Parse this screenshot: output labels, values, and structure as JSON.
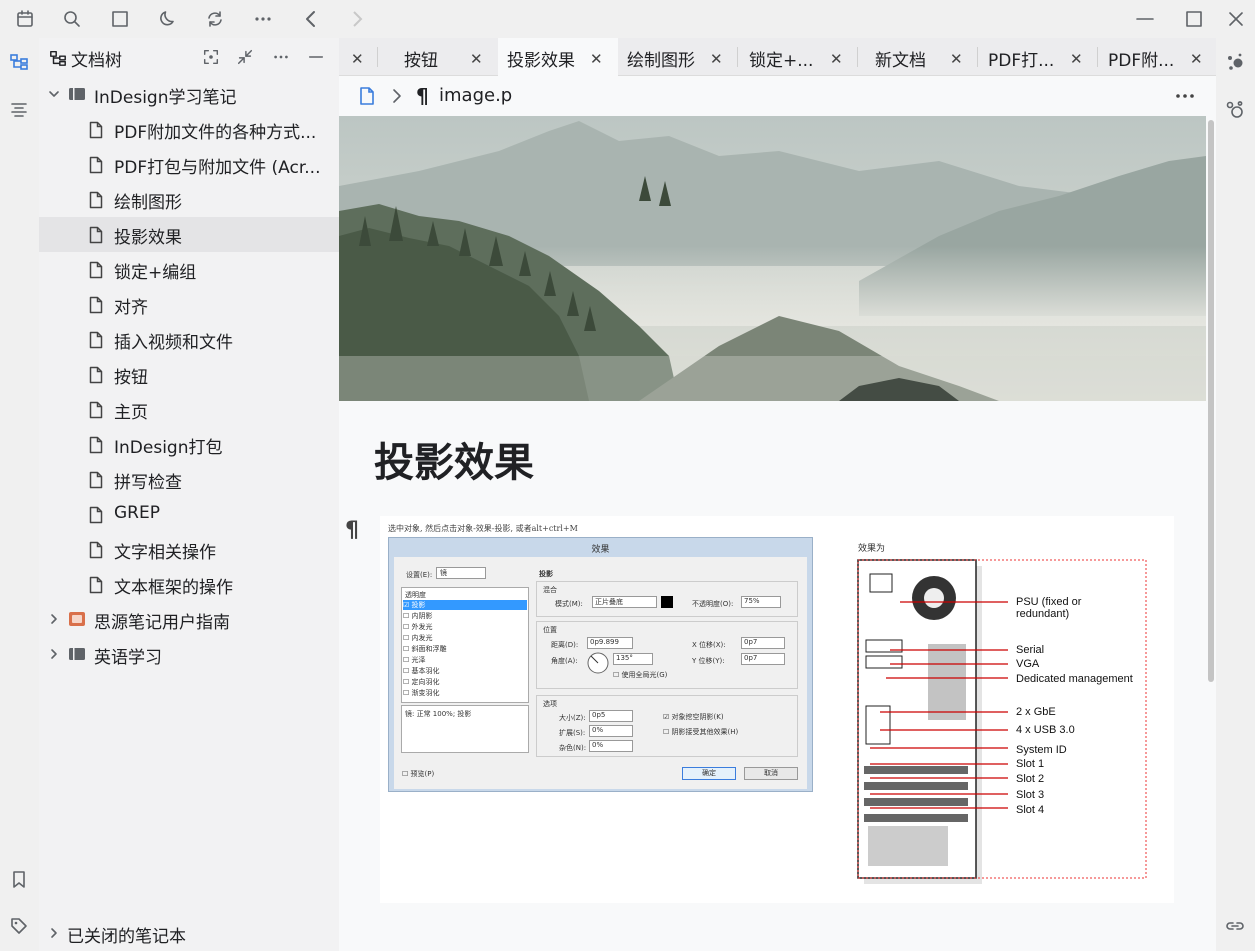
{
  "sidebar": {
    "title": "文档树",
    "notebook": "InDesign学习笔记",
    "docs": [
      "PDF附加文件的各种方式...",
      "PDF打包与附加文件 (Acr...",
      "绘制图形",
      "投影效果",
      "锁定+编组",
      "对齐",
      "插入视频和文件",
      "按钮",
      "主页",
      "InDesign打包",
      "拼写检查",
      "GREP",
      "文字相关操作",
      "文本框架的操作"
    ],
    "selected_index": 3,
    "other_notebooks": [
      "思源笔记用户指南",
      "英语学习"
    ],
    "closed_notebooks": "已关闭的笔记本"
  },
  "tabs": [
    {
      "label": "",
      "active": false
    },
    {
      "label": "按钮",
      "active": false
    },
    {
      "label": "投影效果",
      "active": true
    },
    {
      "label": "绘制图形",
      "active": false
    },
    {
      "label": "锁定+...",
      "active": false
    },
    {
      "label": "新文档",
      "active": false
    },
    {
      "label": "PDF打...",
      "active": false
    },
    {
      "label": "PDF附...",
      "active": false
    }
  ],
  "breadcrumb": {
    "block": "image.p"
  },
  "document": {
    "title": "投影效果"
  },
  "image": {
    "caption": "选中对象, 然后点击对象-效果-投影, 或者alt+ctrl+M",
    "dialog_title": "效果",
    "settings_label": "设置(E):",
    "settings_value": "镜",
    "transparency": "透明度",
    "effects": [
      "投影",
      "内阴影",
      "外发光",
      "内发光",
      "斜面和浮雕",
      "光泽",
      "基本羽化",
      "定向羽化",
      "渐变羽化"
    ],
    "effect_desc": "镜: 正常 100%; 投影",
    "preview": "预览(P)",
    "section_shadow": "投影",
    "blend": "混合",
    "mode_label": "模式(M):",
    "mode_value": "正片叠底",
    "opacity_label": "不透明度(O):",
    "opacity_value": "75%",
    "position": "位置",
    "distance_label": "距离(D):",
    "distance_value": "0p9.899",
    "angle_label": "角度(A):",
    "angle_value": "135°",
    "global_light": "使用全局光(G)",
    "x_label": "X 位移(X):",
    "x_value": "0p7",
    "y_label": "Y 位移(Y):",
    "y_value": "0p7",
    "options": "选项",
    "size_label": "大小(Z):",
    "size_value": "0p5",
    "spread_label": "扩展(S):",
    "spread_value": "0%",
    "noise_label": "杂色(N):",
    "noise_value": "0%",
    "knockout": "对象挖空阴影(K)",
    "honor": "阴影接受其他效果(H)",
    "ok": "确定",
    "cancel": "取消",
    "result_label": "效果为",
    "hw_labels": [
      "PSU (fixed or",
      "redundant)",
      "Serial",
      "VGA",
      "Dedicated management",
      "2 x GbE",
      "4 x USB 3.0",
      "System ID",
      "Slot 1",
      "Slot 2",
      "Slot 3",
      "Slot 4"
    ]
  },
  "colors": {
    "accent": "#3b7ddd",
    "selected_row": "#e4e4e6",
    "notebook_orange": "#d9704a"
  }
}
